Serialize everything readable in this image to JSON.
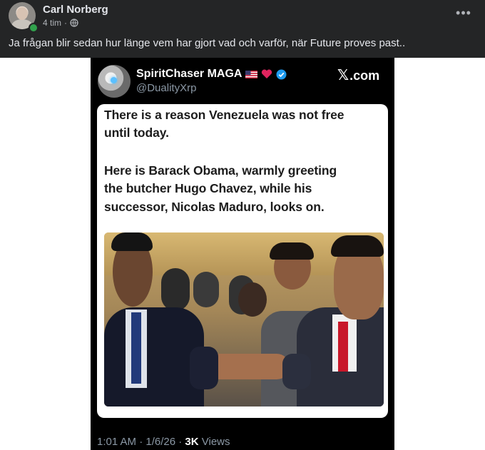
{
  "post": {
    "author": "Carl Norberg",
    "time": "4 tim",
    "separator": "·",
    "text": "Ja frågan blir sedan hur länge vem har gjort vad och varför, när Future proves past..",
    "more_label": "•••"
  },
  "tweet": {
    "display_name": "SpiritChaser MAGA",
    "handle": "@DualityXrp",
    "brand": ".com",
    "card_lines": [
      "There is a reason Venezuela was not free",
      "until today.",
      "Here is Barack Obama, warmly greeting",
      "the butcher Hugo Chavez, while his",
      "successor, Nicolas Maduro, looks on."
    ],
    "timestamp": "1:01 AM · 1/6/26 · ",
    "views_count": "3K",
    "views_label": "Views"
  },
  "icons": [
    "globe-icon",
    "us-flag-icon",
    "heart-icon",
    "verified-icon",
    "x-logo-icon"
  ],
  "colors": {
    "header_bg": "#242526",
    "online": "#31a24c",
    "verified": "#1d9bf0",
    "heart": "#e0245e"
  }
}
